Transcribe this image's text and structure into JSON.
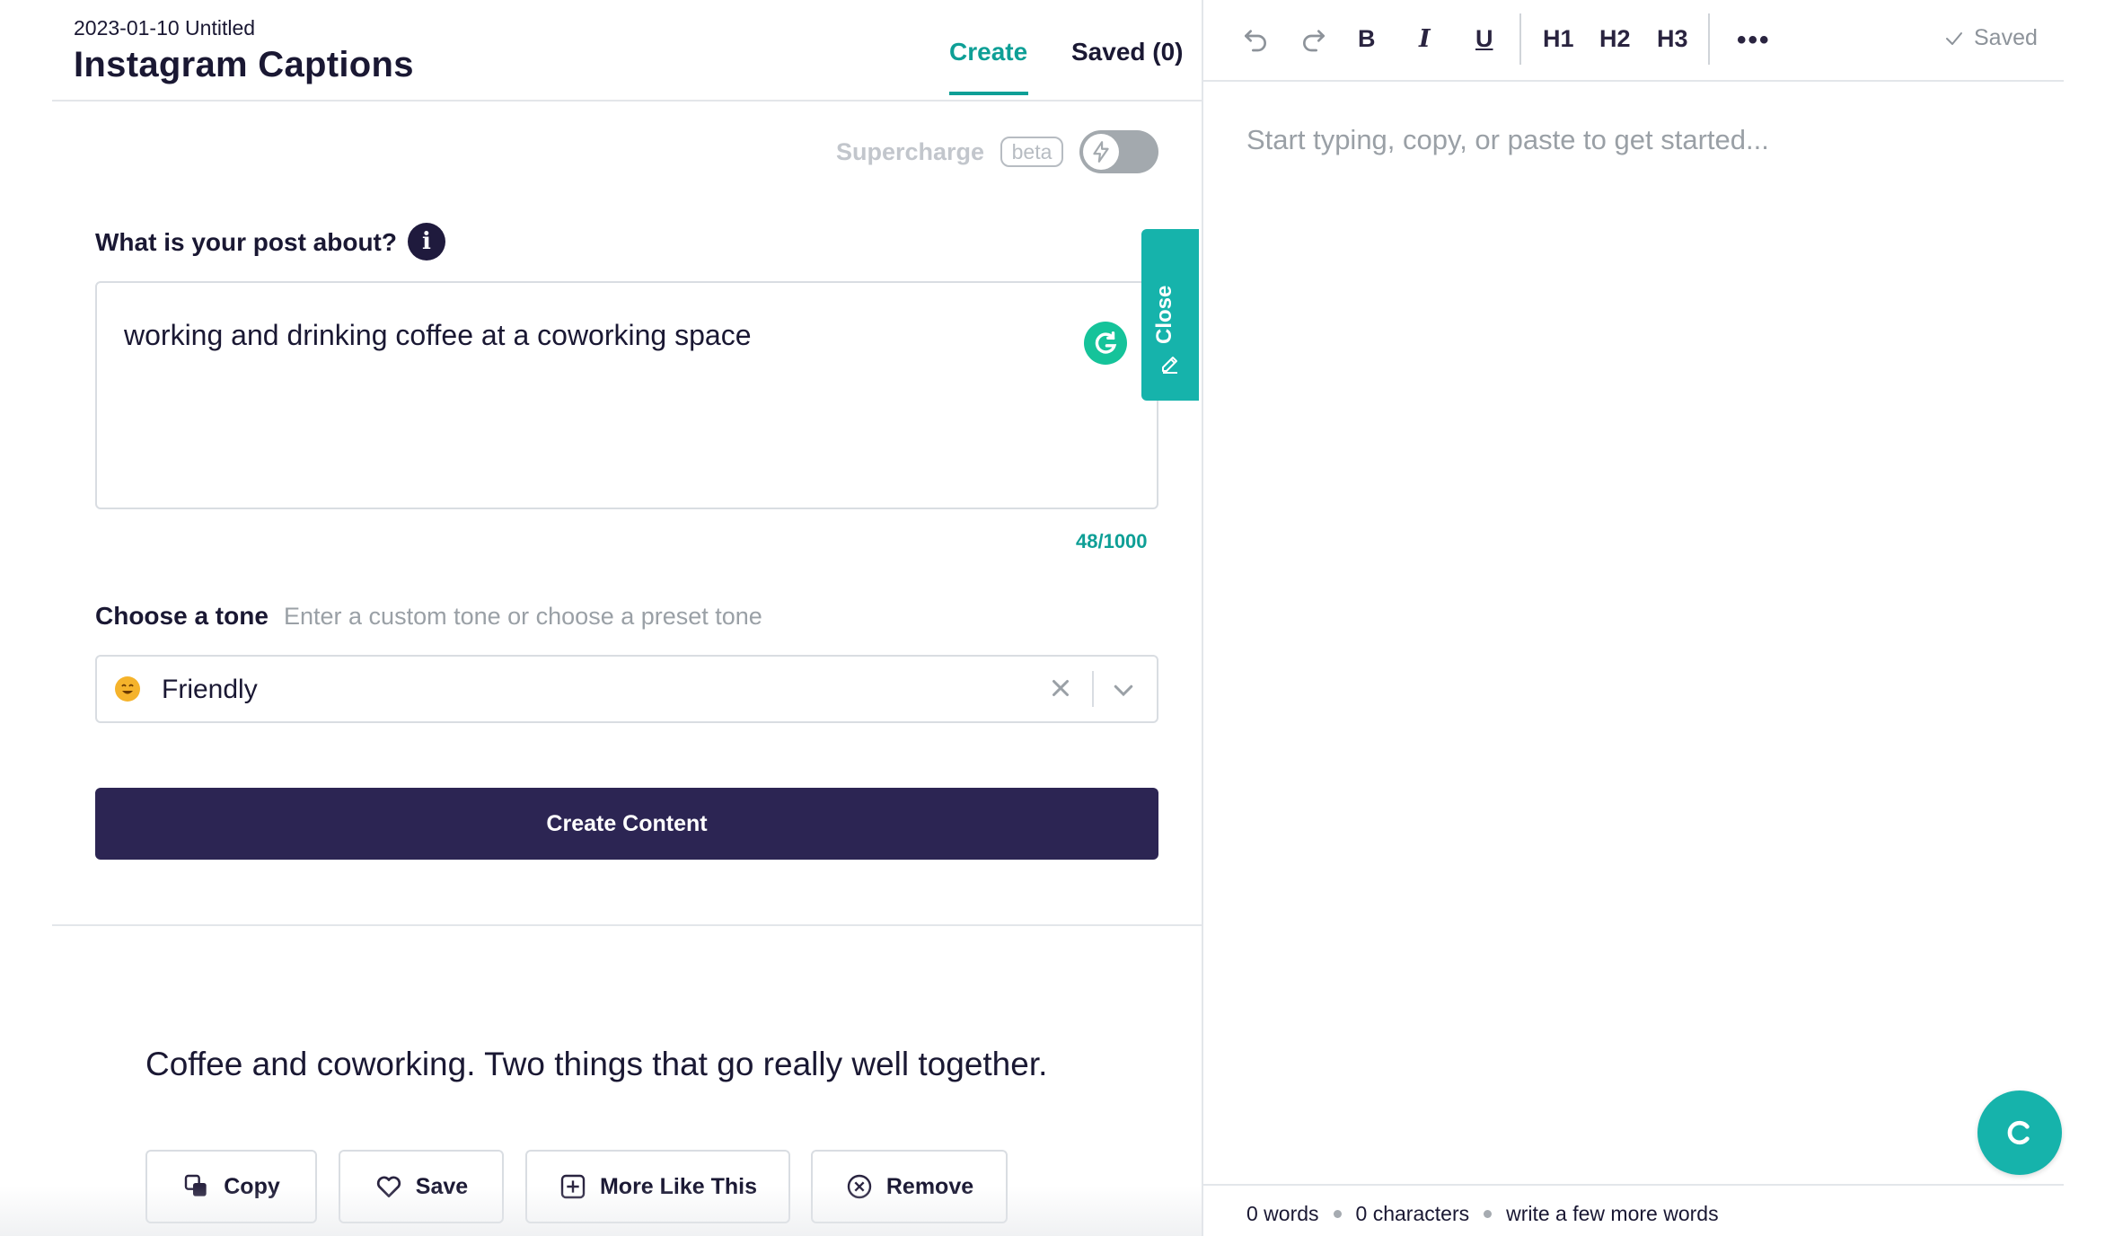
{
  "header": {
    "doc_date": "2023-01-10 Untitled",
    "title": "Instagram Captions",
    "tabs": {
      "create": "Create",
      "saved": "Saved (0)"
    }
  },
  "form": {
    "supercharge_label": "Supercharge",
    "beta_badge": "beta",
    "post_label": "What is your post about?",
    "post_value": "working and drinking coffee at a coworking space",
    "char_count": "48/1000",
    "tone_label": "Choose a tone",
    "tone_hint": "Enter a custom tone or choose a preset tone",
    "tone_value": "Friendly",
    "create_button": "Create Content",
    "close_tab": "Close"
  },
  "result": {
    "text": "Coffee and coworking. Two things that go really well together.",
    "actions": {
      "copy": "Copy",
      "save": "Save",
      "more": "More Like This",
      "remove": "Remove"
    }
  },
  "editor": {
    "toolbar": {
      "bold": "B",
      "italic": "I",
      "underline": "U",
      "h1": "H1",
      "h2": "H2",
      "h3": "H3",
      "more": "•••",
      "saved": "Saved"
    },
    "placeholder": "Start typing, copy, or paste to get started...",
    "status": {
      "words": "0 words",
      "characters": "0 characters",
      "hint": "write a few more words"
    }
  },
  "colors": {
    "accent": "#0e9f96",
    "teal": "#16b3ab",
    "primary_button": "#2c2553",
    "text": "#1a1833",
    "muted": "#9aa0a6"
  },
  "icons": [
    "info-icon",
    "grammarly-icon",
    "lightning-icon",
    "pencil-icon",
    "clear-icon",
    "chevron-down-icon",
    "copy-icon",
    "heart-icon",
    "plus-square-icon",
    "x-circle-icon",
    "undo-icon",
    "redo-icon",
    "more-icon",
    "check-icon",
    "chat-icon"
  ]
}
